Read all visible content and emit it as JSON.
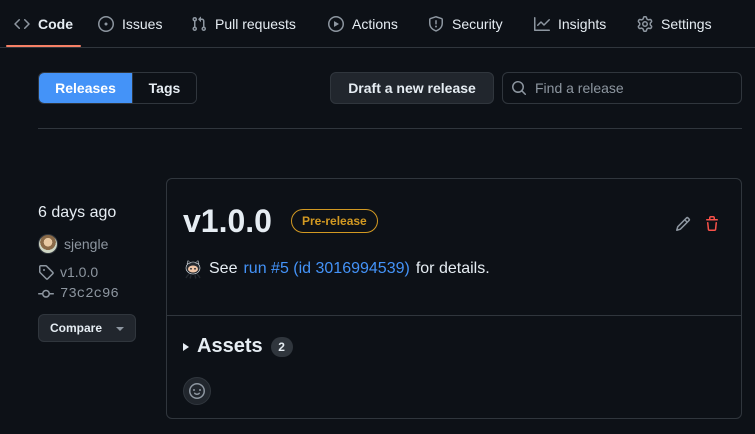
{
  "nav": {
    "items": [
      {
        "label": "Code",
        "icon": "code-icon",
        "selected": true
      },
      {
        "label": "Issues",
        "icon": "issue-opened-icon"
      },
      {
        "label": "Pull requests",
        "icon": "git-pull-request-icon"
      },
      {
        "label": "Actions",
        "icon": "play-icon"
      },
      {
        "label": "Security",
        "icon": "shield-icon"
      },
      {
        "label": "Insights",
        "icon": "graph-icon"
      },
      {
        "label": "Settings",
        "icon": "gear-icon"
      }
    ],
    "accent_color": "#f78166"
  },
  "toolbar": {
    "tabs": [
      {
        "label": "Releases",
        "active": true
      },
      {
        "label": "Tags",
        "active": false
      }
    ],
    "draft_label": "Draft a new release",
    "search_placeholder": "Find a release"
  },
  "release": {
    "time_ago": "6 days ago",
    "author": "sjengle",
    "tag": "v1.0.0",
    "commit": "73c2c96",
    "compare_label": "Compare",
    "title": "v1.0.0",
    "badge": "Pre-release",
    "badge_color": "#d29922",
    "body": {
      "prefix": "See",
      "link": "run #5 (id 3016994539)",
      "suffix": "for details."
    },
    "assets_label": "Assets",
    "assets_count": "2",
    "delete_color": "#f85149",
    "link_color": "#4493f8"
  }
}
